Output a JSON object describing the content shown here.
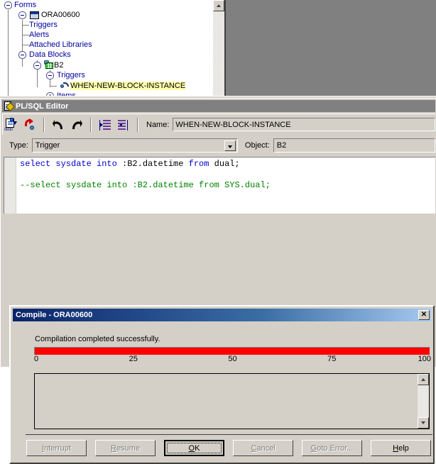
{
  "navigator": {
    "tree": [
      {
        "label": "Forms",
        "depth": 0,
        "state": "expanded",
        "icon": "none",
        "highlighted": false
      },
      {
        "label": "ORA00600",
        "depth": 1,
        "state": "expanded",
        "icon": "form-icon",
        "highlighted": false,
        "black": true
      },
      {
        "label": "Triggers",
        "depth": 2,
        "state": "leaf",
        "icon": "none",
        "highlighted": false
      },
      {
        "label": "Alerts",
        "depth": 2,
        "state": "leaf",
        "icon": "none",
        "highlighted": false
      },
      {
        "label": "Attached Libraries",
        "depth": 2,
        "state": "leaf",
        "icon": "none",
        "highlighted": false
      },
      {
        "label": "Data Blocks",
        "depth": 2,
        "state": "expanded",
        "icon": "none",
        "highlighted": false
      },
      {
        "label": "B2",
        "depth": 3,
        "state": "expanded",
        "icon": "block-icon",
        "highlighted": false,
        "black": true
      },
      {
        "label": "Triggers",
        "depth": 4,
        "state": "expanded",
        "icon": "none",
        "highlighted": false
      },
      {
        "label": "WHEN-NEW-BLOCK-INSTANCE",
        "depth": 5,
        "state": "leaf",
        "icon": "trigger-icon",
        "highlighted": true
      },
      {
        "label": "Items",
        "depth": 4,
        "state": "collapsed",
        "icon": "none",
        "highlighted": false
      }
    ],
    "scrollbar": {
      "up_arrow": "scroll-up-arrow",
      "down_arrow": "scroll-down-arrow"
    }
  },
  "editor": {
    "title": "PL/SQL Editor",
    "title_icon": "plsql-editor-icon",
    "toolbar": {
      "compile_icon": "compile-icon",
      "compile_icon_digits": "01010",
      "revert_icon": "revert-icon",
      "undo_icon": "undo-arrow-icon",
      "redo_icon": "redo-arrow-icon",
      "indent_icon": "indent-right-icon",
      "outdent_icon": "indent-left-icon"
    },
    "name_label": "Name:",
    "name_value": "WHEN-NEW-BLOCK-INSTANCE",
    "type_label": "Type:",
    "type_value": "Trigger",
    "type_options": [
      "Trigger"
    ],
    "object_label": "Object:",
    "object_value": "B2",
    "code_lines": [
      [
        {
          "t": "select sysdate into ",
          "c": "kw"
        },
        {
          "t": ":B2.datetime ",
          "c": "pl"
        },
        {
          "t": "from ",
          "c": "kw"
        },
        {
          "t": "dual;",
          "c": "pl"
        }
      ],
      [
        {
          "t": "",
          "c": "pl"
        }
      ],
      [
        {
          "t": "--select sysdate into :B2.datetime from SYS.dual;",
          "c": "cm"
        }
      ]
    ],
    "syntax_colors": {
      "keyword": "#0000c8",
      "plain": "#000000",
      "comment": "#008000"
    }
  },
  "dialog": {
    "title": "Compile - ORA00600",
    "close_label": "✕",
    "status_text": "Compilation completed successfully.",
    "progress": {
      "percent": 100,
      "color": "#ff0000",
      "ticks": [
        "0",
        "25",
        "50",
        "75",
        "100"
      ]
    },
    "message_list": [],
    "buttons": [
      {
        "name": "interrupt-button",
        "label": "Interrupt",
        "accel": "I",
        "enabled": false,
        "default": false
      },
      {
        "name": "resume-button",
        "label": "Resume",
        "accel": "R",
        "enabled": false,
        "default": false
      },
      {
        "name": "ok-button",
        "label": "OK",
        "accel": "O",
        "enabled": true,
        "default": true
      },
      {
        "name": "cancel-button",
        "label": "Cancel",
        "accel": "C",
        "enabled": false,
        "default": false
      },
      {
        "name": "goto-error-button",
        "label": "Goto Error...",
        "accel": "G",
        "enabled": false,
        "default": false
      },
      {
        "name": "help-button",
        "label": "Help",
        "accel": "H",
        "enabled": true,
        "default": false
      }
    ]
  },
  "colors": {
    "window_face": "#d4d0c8",
    "mdi_background": "#808080",
    "title_inactive": "#808080",
    "dialog_title_start": "#0a246a",
    "highlight_yellow": "#ffffac",
    "tree_link": "#00009e"
  }
}
